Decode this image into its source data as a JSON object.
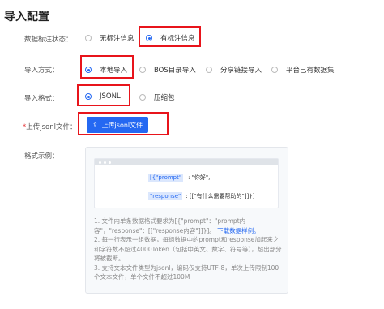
{
  "page_title": "导入配置",
  "annotation_status": {
    "label": "数据标注状态：",
    "options": [
      "无标注信息",
      "有标注信息"
    ]
  },
  "import_method": {
    "label": "导入方式：",
    "options": [
      "本地导入",
      "BOS目录导入",
      "分享链接导入",
      "平台已有数据集"
    ]
  },
  "import_format": {
    "label": "导入格式：",
    "options": [
      "JSONL",
      "压缩包"
    ]
  },
  "upload": {
    "required_mark": "*",
    "label": "上传jsonl文件：",
    "button_label": "上传jsonl文件"
  },
  "example": {
    "label": "格式示例：",
    "prompt_key": "[{\"prompt\"",
    "prompt_value": ": \"你好\",",
    "response_key": "\"response\"",
    "response_value": ": [[\"有什么需要帮助的\"]]}]",
    "note1_text": "1. 文件内单条数据格式要求为[{\"prompt\"：\"prompt内容\"，\"response\"：[[\"response内容\"]]}]。",
    "note1_link": "下载数据样例。",
    "note2": "2. 每一行表示一组数据，每组数据中的prompt和response加起来之和字符数不超过4000Token（包括中英文、数字、符号等），超出部分将被截断。",
    "note3": "3. 支持文本文件类型为jsonl，编码仅支持UTF-8，单次上传限制100个文本文件，单个文件不超过100M"
  },
  "colors": {
    "accent": "#2468f2",
    "highlight_border": "#e8141b"
  }
}
